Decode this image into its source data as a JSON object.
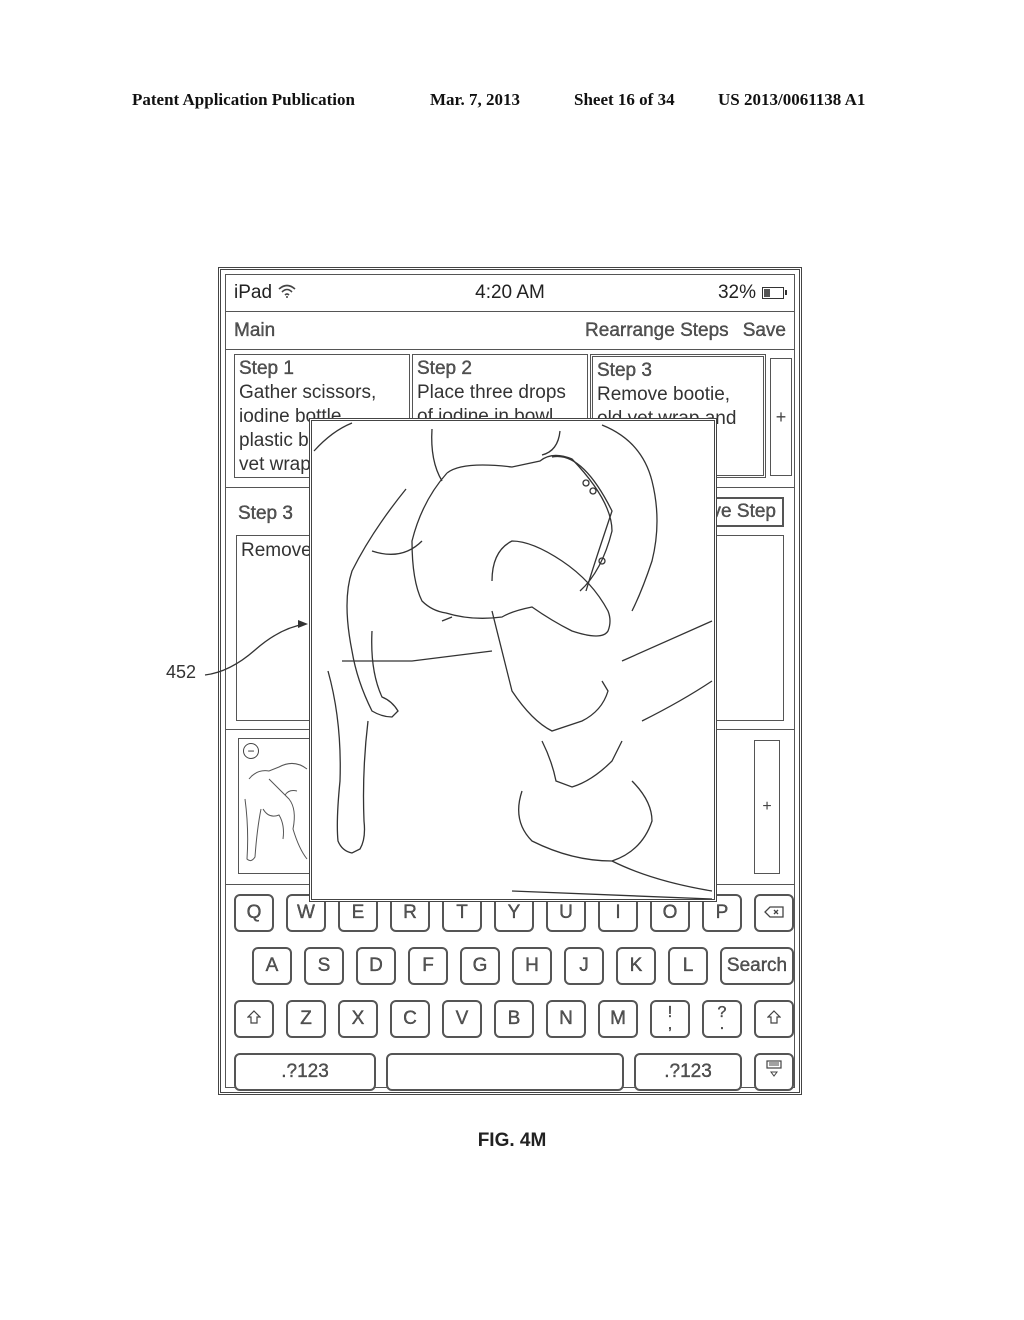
{
  "publication_header": {
    "title": "Patent Application Publication",
    "date": "Mar. 7, 2013",
    "sheet": "Sheet 16 of 34",
    "number": "US 2013/0061138 A1"
  },
  "status_bar": {
    "device": "iPad",
    "wifi_icon": "wifi-icon",
    "time": "4:20 AM",
    "battery_percent": "32%",
    "battery_level": 0.32,
    "battery_icon": "battery-icon"
  },
  "nav_bar": {
    "back_label": "Main",
    "rearrange_label": "Rearrange Steps",
    "save_label": "Save"
  },
  "steps": [
    {
      "title": "Step 1",
      "text": "Gather scissors, iodine bottle, plastic bowl gauze, vet wrap and medicine"
    },
    {
      "title": "Step 2",
      "text": "Place three drops of iodine in bowl half full"
    },
    {
      "title": "Step 3",
      "text": "Remove bootie, old vet wrap and gauze from",
      "selected": true
    }
  ],
  "add_step_icon": "plus-icon",
  "add_step_symbol": "+",
  "detail": {
    "title": "Step 3",
    "remove_label": "Remove Step",
    "text": "Remove bootie, old vet wrap and gauze from"
  },
  "media": {
    "remove_icon": "minus-circle-icon",
    "remove_symbol": "−",
    "add_icon": "plus-icon",
    "add_symbol": "+"
  },
  "keyboard": {
    "row1": [
      "Q",
      "W",
      "E",
      "R",
      "T",
      "Y",
      "U",
      "I",
      "O",
      "P"
    ],
    "backspace_icon": "backspace-icon",
    "row2": [
      "A",
      "S",
      "D",
      "F",
      "G",
      "H",
      "J",
      "K",
      "L"
    ],
    "search_label": "Search",
    "shift_icon": "shift-icon",
    "row3": [
      "Z",
      "X",
      "C",
      "V",
      "B",
      "N",
      "M"
    ],
    "punct": [
      {
        "top": "!",
        "bottom": ","
      },
      {
        "top": "?",
        "bottom": "."
      }
    ],
    "numbers_label": ".?123",
    "hide_keyboard_icon": "hide-keyboard-icon"
  },
  "overlay": {
    "image_icon": "enlarged-photo-dog-paw-bandage"
  },
  "callout": {
    "label": "452"
  },
  "figure_label": "FIG. 4M"
}
